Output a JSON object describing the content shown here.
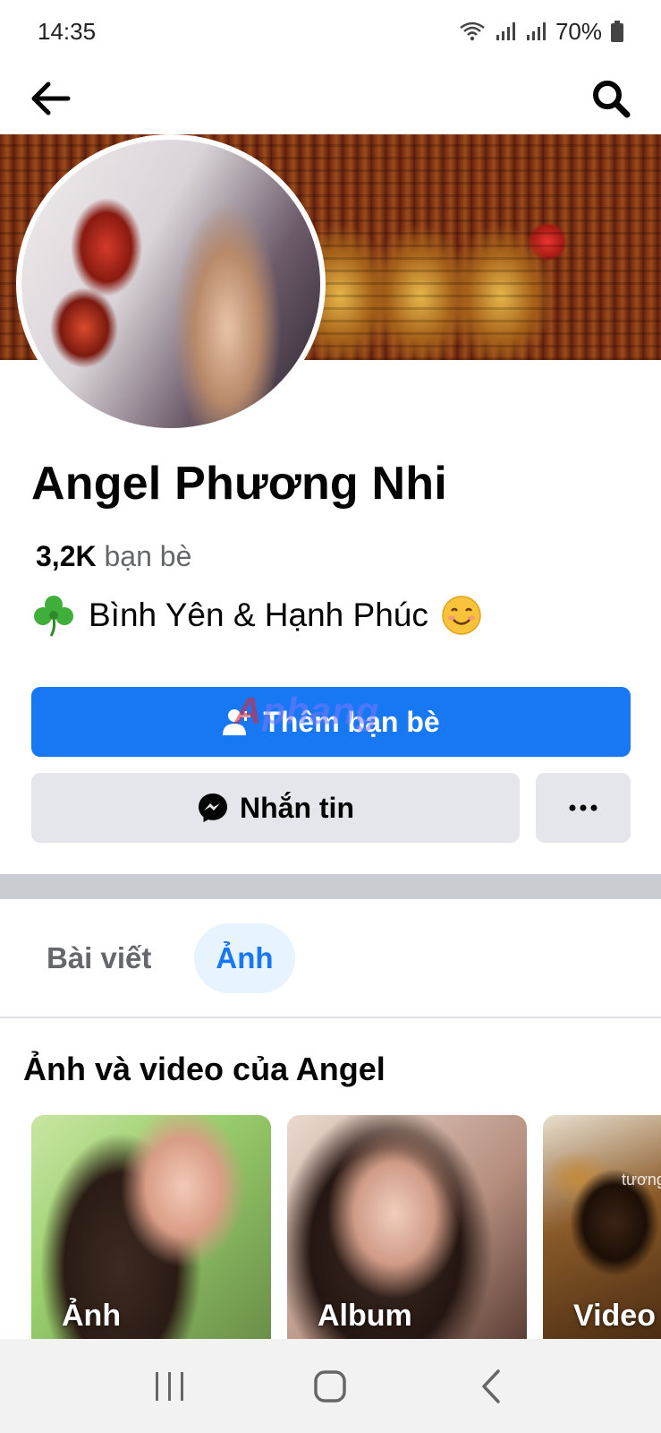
{
  "status_bar": {
    "time": "14:35",
    "battery": "70%",
    "icons": [
      "wifi-icon",
      "signal-icon",
      "signal-icon",
      "battery-icon"
    ]
  },
  "top_nav": {
    "back_icon": "back-arrow-icon",
    "search_icon": "search-icon"
  },
  "profile": {
    "name": "Angel Phương Nhi",
    "friends_count": "3,2K",
    "friends_label": "bạn bè",
    "bio_text": "Bình Yên & Hạnh Phúc",
    "bio_leading_emoji": "shamrock-icon",
    "bio_trailing_emoji": "smiling-face-icon"
  },
  "actions": {
    "add_friend_label": "Thêm bạn bè",
    "message_label": "Nhắn tin",
    "more_label": "···"
  },
  "watermark": {
    "prefix": "A",
    "text": "phang"
  },
  "tabs": [
    {
      "label": "Bài viết",
      "active": false
    },
    {
      "label": "Ảnh",
      "active": true
    }
  ],
  "media": {
    "title": "Ảnh và video của Angel",
    "cards": [
      {
        "label": "Ảnh"
      },
      {
        "label": "Album"
      },
      {
        "label": "Video",
        "overlay_text": "tương"
      }
    ]
  },
  "colors": {
    "primary": "#1877f2",
    "secondary_button": "#e4e6eb",
    "tab_active_bg": "#e7f3ff",
    "text_secondary": "#65676b"
  }
}
